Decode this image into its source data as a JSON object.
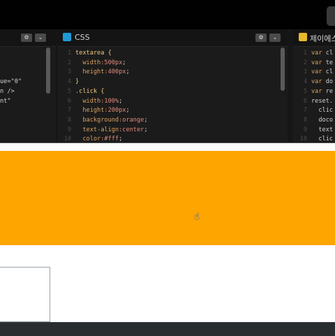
{
  "html_panel": {
    "lines": [
      "",
      "",
      "",
      "ue=\"0\"",
      "n />",
      "nt\"",
      "",
      "",
      "",
      ""
    ]
  },
  "css_panel": {
    "title": "CSS",
    "icon": "css-icon",
    "gear_icon": "gear-icon",
    "chevron_icon": "chevron-down-icon",
    "line_numbers": [
      "1",
      "2",
      "3",
      "4",
      "5",
      "6",
      "7",
      "8",
      "9",
      "10"
    ],
    "lines": [
      {
        "a": "textarea {",
        "b": "",
        "c": ""
      },
      {
        "a": "  width",
        "b": ":500px",
        "c": ";"
      },
      {
        "a": "  height",
        "b": ":400px",
        "c": ";"
      },
      {
        "a": "}",
        "b": "",
        "c": ""
      },
      {
        "a": ".click {",
        "b": "",
        "c": ""
      },
      {
        "a": "  width",
        "b": ":100%",
        "c": ";"
      },
      {
        "a": "  height",
        "b": ":200px",
        "c": ";"
      },
      {
        "a": "  background",
        "b": ":orange",
        "c": ";"
      },
      {
        "a": "  text-align",
        "b": ":center",
        "c": ";"
      },
      {
        "a": "  color",
        "b": ":#fff",
        "c": ";"
      }
    ]
  },
  "js_panel": {
    "title": "제이에스",
    "icon": "js-icon",
    "line_numbers": [
      "1",
      "2",
      "3",
      "4",
      "5",
      "6",
      "7",
      "8",
      "9",
      "10"
    ],
    "lines": [
      "var cl",
      "var te",
      "var cl",
      "var do",
      "var re",
      "reset.",
      "  clic",
      "  doco",
      "  text",
      "  clic"
    ]
  },
  "colors": {
    "preview_bg": "#ffa500",
    "editor_bg": "#1b1b1b"
  }
}
